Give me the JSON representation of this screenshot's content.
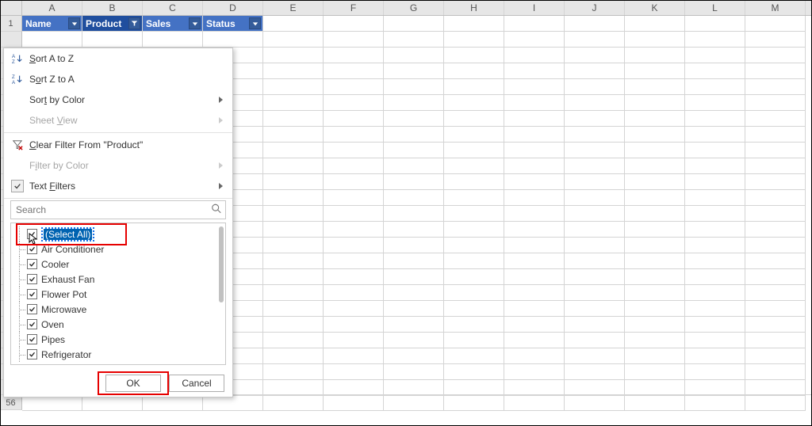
{
  "columns": [
    "A",
    "B",
    "C",
    "D",
    "E",
    "F",
    "G",
    "H",
    "I",
    "J",
    "K",
    "L",
    "M"
  ],
  "header_cells": [
    {
      "label": "Name"
    },
    {
      "label": "Product"
    },
    {
      "label": "Sales"
    },
    {
      "label": "Status"
    }
  ],
  "row_nums_visible": [
    "1"
  ],
  "tail_row_num": "56",
  "menu": {
    "sort_az": "Sort A to Z",
    "sort_za": "Sort Z to A",
    "sort_color": "Sort by Color",
    "sheet_view": "Sheet View",
    "clear": "Clear Filter From \"Product\"",
    "filter_color": "Filter by Color",
    "text_filters": "Text Filters"
  },
  "search": {
    "placeholder": "Search"
  },
  "tree_items": [
    {
      "label": "(Select All)",
      "highlight": true
    },
    {
      "label": "Air Conditioner"
    },
    {
      "label": "Cooler"
    },
    {
      "label": "Exhaust Fan"
    },
    {
      "label": "Flower Pot"
    },
    {
      "label": "Microwave"
    },
    {
      "label": "Oven"
    },
    {
      "label": "Pipes"
    },
    {
      "label": "Refrigerator"
    }
  ],
  "buttons": {
    "ok": "OK",
    "cancel": "Cancel"
  }
}
